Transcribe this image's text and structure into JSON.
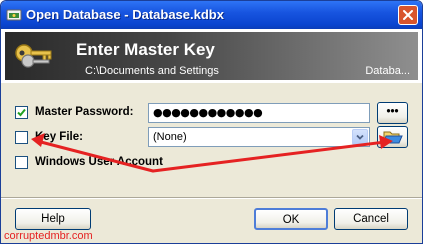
{
  "window": {
    "title": "Open Database - Database.kdbx"
  },
  "header": {
    "title": "Enter Master Key",
    "path": "C:\\Documents and Settings",
    "file": "Databa..."
  },
  "form": {
    "master_password": {
      "label": "Master Password:",
      "checked": true,
      "value": "●●●●●●●●●●●●",
      "reveal_button": "•••"
    },
    "key_file": {
      "label": "Key File:",
      "checked": false,
      "selected": "(None)"
    },
    "windows_user_account": {
      "label": "Windows User Account",
      "checked": false
    }
  },
  "buttons": {
    "help": "Help",
    "ok": "OK",
    "cancel": "Cancel"
  },
  "watermark": "corruptedmbr.com",
  "colors": {
    "title_bar": "#0a44cf",
    "annotation": "#e52222",
    "dialog_bg": "#ece9d8"
  }
}
